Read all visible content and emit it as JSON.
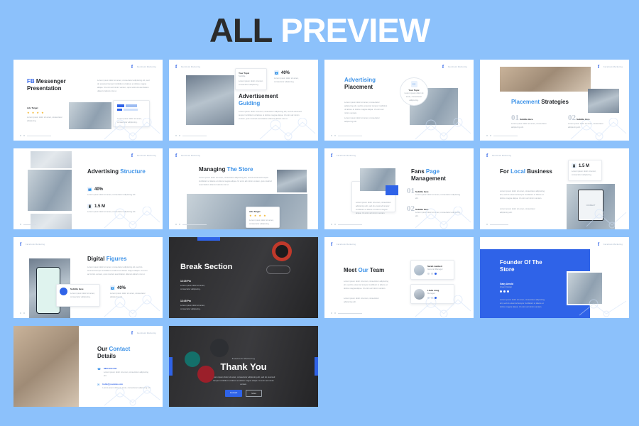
{
  "page": {
    "background_color": "#8cc1fb",
    "title_part1": "ALL",
    "title_part2": "PREVIEW",
    "title_color_1": "#2b2b2b",
    "title_color_2": "#ffffff",
    "accent_blue": "#3e93e8",
    "brand_blue": "#2f63e8"
  },
  "brand": {
    "f": "f",
    "label": "Facebook Marketing"
  },
  "lorem": {
    "short": "Lorem ipsum dolor sit amet, consectetur adipiscing elit.",
    "medium": "Lorem ipsum dolor sit amet, consectetur adipiscing elit, sed do eiusmod tempor incididunt ut labore et dolore magna aliqua. Ut enim ad minim veniam.",
    "long": "Lorem ipsum dolor sit amet, consectetur adipiscing elit, sed do eiusmod tempor incididunt ut labore et dolore magna aliqua. Ut enim ad minim veniam, quis nostrud exercitation ullamco laboris nisi ut.",
    "tiny": "Lorem ipsum dolor sit amet, consectetur adipiscing."
  },
  "slides": [
    {
      "id": 1,
      "name": "fb-messenger-presentation",
      "title_accent": "FB",
      "title_rest": " Messenger",
      "title_line2": "Presentation",
      "card_label": "Ads Target",
      "stars": "★ ★ ★ ★",
      "body": "Lorem ipsum dolor sit amet, consectetur adipiscing elit, sed do eiusmod tempor incididunt ut labore et dolore magna aliqua. Ut enim ad minim veniam, quis nostrud exercitation ullamco laboris nisi ut."
    },
    {
      "id": 2,
      "name": "advertisement-guiding",
      "title_main": "Advertisement",
      "title_accent": "Guiding",
      "card_title": "Your Topic",
      "card_sub": "Subtitle",
      "stat_value": "40%",
      "stat_icon": "users-icon"
    },
    {
      "id": 3,
      "name": "advertising-placement",
      "title_accent": "Advertising",
      "title_main": "Placement",
      "circle_title": "Your Topic",
      "circle_icon": "window-icon"
    },
    {
      "id": 4,
      "name": "placement-strategies",
      "title_accent": "Placement",
      "title_main": "Strategies",
      "items": [
        {
          "number": "01",
          "label": "Subtitle Here"
        },
        {
          "number": "02",
          "label": "Subtitle Here"
        }
      ]
    },
    {
      "id": 5,
      "name": "advertising-structure",
      "title_main": "Advertising",
      "title_accent": "Structure",
      "stats": [
        {
          "value": "40%",
          "icon": "users-icon"
        },
        {
          "value": "1.5 M",
          "icon": "phone-icon"
        }
      ]
    },
    {
      "id": 6,
      "name": "managing-the-store",
      "title_main": "Managing",
      "title_accent": "The Store",
      "card_label": "Ads Target",
      "stars": "★ ★ ★ ★"
    },
    {
      "id": 7,
      "name": "fans-page-management",
      "title_main": "Fans",
      "title_accent": "Page",
      "title_line2": "Management",
      "items": [
        {
          "number": "01",
          "label": "Subtitle Here"
        },
        {
          "number": "02",
          "label": "Subtitle Here"
        }
      ]
    },
    {
      "id": 8,
      "name": "for-local-business",
      "title_pre": "For ",
      "title_accent": "Local",
      "title_post": " Business",
      "stat_value": "1.5 M",
      "stat_icon": "phone-icon",
      "device_label": "CONNECT"
    },
    {
      "id": 9,
      "name": "digital-figures",
      "title_main": "Digital",
      "title_accent": "Figures",
      "card_label": "Subtitle Here",
      "card_icon": "messenger-icon",
      "stat_value": "40%",
      "stat_icon": "users-icon"
    },
    {
      "id": 10,
      "name": "break-section",
      "title": "Break Section",
      "theme": "dark",
      "times": [
        {
          "time": "12:15 Pm"
        },
        {
          "time": "12:45 Pm"
        }
      ]
    },
    {
      "id": 11,
      "name": "meet-our-team",
      "title_pre": "Meet ",
      "title_accent": "Our",
      "title_post": " Team",
      "members": [
        {
          "name": "Sarah Lambert",
          "role": "General Manager"
        },
        {
          "name": "Linda Long",
          "role": "Manager"
        }
      ]
    },
    {
      "id": 12,
      "name": "founder-of-the-store",
      "title_line1": "Founder Of The",
      "title_line2": "Store",
      "person_name": "Gaby Arnold",
      "person_role": "Green Design",
      "theme": "blue"
    },
    {
      "id": 13,
      "name": "our-contact-details",
      "title_pre": "Our ",
      "title_accent": "Contact",
      "title_line2": "Details",
      "contacts": [
        {
          "icon": "phone-icon",
          "value": "0800 000 000"
        },
        {
          "icon": "mail-icon",
          "value": "hello@yoursite.com"
        }
      ]
    },
    {
      "id": 14,
      "name": "thank-you",
      "eyebrow": "Facebook Marketing",
      "title": "Thank You",
      "theme": "dark",
      "buttons": [
        {
          "label": "Contact",
          "style": "primary"
        },
        {
          "label": "More",
          "style": "ghost"
        }
      ]
    }
  ]
}
